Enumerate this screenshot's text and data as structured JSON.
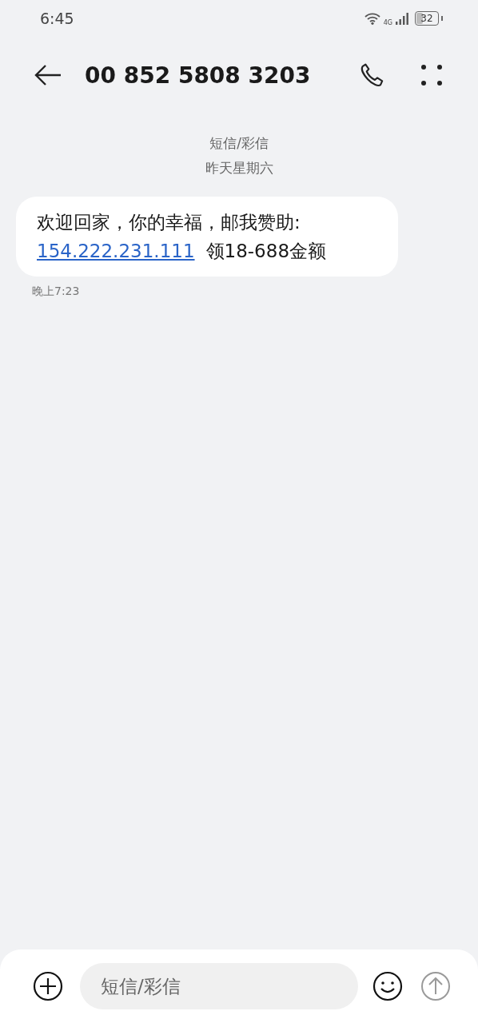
{
  "status_bar": {
    "time": "6:45",
    "network": "4G",
    "battery": "32"
  },
  "header": {
    "title": "00 852 5808 3203"
  },
  "conversation": {
    "channel": "短信/彩信",
    "date": "昨天星期六"
  },
  "messages": [
    {
      "lines": [
        [
          {
            "kind": "text",
            "text": "欢迎回家，你的幸福，邮我赞助:"
          }
        ],
        [
          {
            "kind": "link",
            "text": "154.222.231.111"
          },
          {
            "kind": "text",
            "text": "领18-688金额"
          }
        ]
      ],
      "time": "晚上7:23"
    }
  ],
  "composer": {
    "placeholder": "短信/彩信",
    "send_disabled": true
  }
}
